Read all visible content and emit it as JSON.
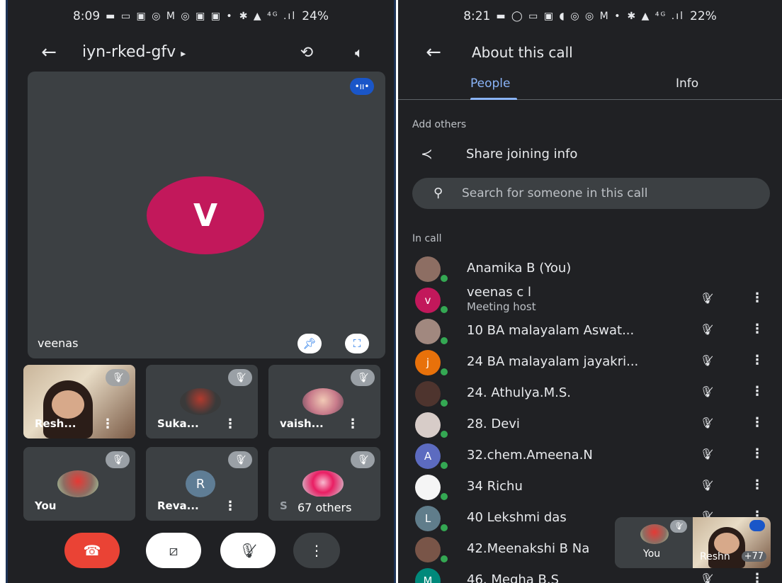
{
  "left": {
    "status_time": "8:09",
    "status_icons": "▬ ▭ ▣ ◎ M ◎ ▣ ▣ •",
    "status_right": "✱ ▲ ⁴ᴳ .ıl",
    "battery": "24%",
    "meeting_title": "iyn-rked-gfv",
    "main_avatar_letter": "V",
    "main_name": "veenas",
    "tiles": [
      {
        "label": "Resh...",
        "type": "video"
      },
      {
        "label": "Suka...",
        "type": "photo"
      },
      {
        "label": "vaish...",
        "type": "photo"
      },
      {
        "label": "You",
        "type": "photo"
      },
      {
        "label": "Reva...",
        "letter": "R"
      },
      {
        "label": "Se"
      }
    ],
    "others_label": "67 others"
  },
  "right": {
    "status_time": "8:21",
    "status_icons": "▬ ◯ ▭ ▣ ◖ ◎ ◎ M •",
    "status_right": "✱ ▲ ⁴ᴳ .ıl",
    "battery": "22%",
    "title": "About this call",
    "tabs": [
      "People",
      "Info"
    ],
    "add_others_label": "Add others",
    "share_label": "Share joining info",
    "search_placeholder": "Search for someone in this call",
    "in_call_label": "In call",
    "people": [
      {
        "name": "Anamika B (You)",
        "avatar": "photo",
        "color": "#8d6e63"
      },
      {
        "name": "veenas c l",
        "sub": "Meeting host",
        "letter": "v",
        "color": "#c2185b"
      },
      {
        "name": "10 BA malayalam Aswat...",
        "avatar": "photo",
        "color": "#a1887f"
      },
      {
        "name": "24 BA malayalam jayakri...",
        "letter": "j",
        "color": "#e8710a"
      },
      {
        "name": "24. Athulya.M.S.",
        "avatar": "photo",
        "color": "#4e342e"
      },
      {
        "name": "28. Devi",
        "avatar": "photo",
        "color": "#d7ccc8"
      },
      {
        "name": "32.chem.Ameena.N",
        "letter": "A",
        "color": "#5c6bc0"
      },
      {
        "name": "34 Richu",
        "avatar": "photo",
        "color": "#f5f5f5"
      },
      {
        "name": "40 Lekshmi das",
        "letter": "L",
        "color": "#607d8b"
      },
      {
        "name": "42.Meenakshi B Na",
        "avatar": "photo",
        "color": "#795548"
      },
      {
        "name": "46. Megha B.S",
        "letter": "M",
        "color": "#00897b"
      }
    ],
    "pip": {
      "you_label": "You",
      "other_label": "Reshn",
      "count": "+77"
    }
  },
  "colors": {
    "end_call": "#ea4335",
    "accent": "#8ab4f8",
    "host": "#c2185b"
  }
}
